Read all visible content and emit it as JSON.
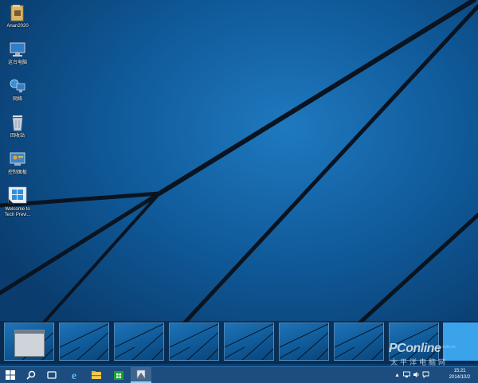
{
  "desktop": {
    "icons": [
      {
        "name": "folder-icon",
        "label": "Anan2020"
      },
      {
        "name": "this-pc-icon",
        "label": "这台电脑"
      },
      {
        "name": "network-icon",
        "label": "网络"
      },
      {
        "name": "recycle-bin-icon",
        "label": "回收站"
      },
      {
        "name": "control-panel-icon",
        "label": "控制面板"
      },
      {
        "name": "welcome-icon",
        "label": "Welcome to Tech Previ..."
      }
    ]
  },
  "virtual_desktops": {
    "count": 8,
    "active_index": 0,
    "add_button": "add-desktop-button"
  },
  "taskbar": {
    "buttons": [
      {
        "name": "start-icon"
      },
      {
        "name": "search-icon"
      },
      {
        "name": "task-view-icon"
      },
      {
        "name": "internet-explorer-icon"
      },
      {
        "name": "file-explorer-icon"
      },
      {
        "name": "store-icon"
      },
      {
        "name": "pinned-app-icon"
      }
    ],
    "clock": {
      "time": "15:21",
      "date": "2014/10/2"
    }
  },
  "watermark": {
    "brand": "PConline",
    "chinese": "太平洋电脑网",
    "domain": ".com.cn"
  },
  "colors": {
    "wallpaper": "#0f5897",
    "taskbar": "#1c4d7e",
    "accent": "#3aa3ea"
  }
}
